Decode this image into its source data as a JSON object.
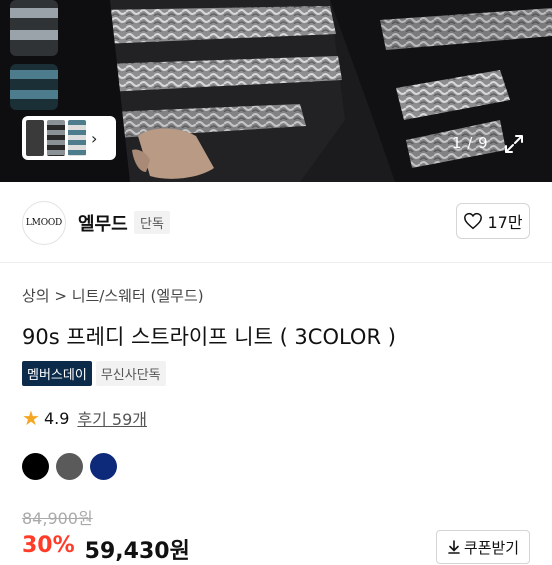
{
  "gallery": {
    "counter": "1 / 9",
    "thumb_set_arrow": "›",
    "thumb_colors": [
      "#9aa3aa",
      "#4d7d8c",
      "#2a2a2a"
    ]
  },
  "brand": {
    "logo_text": "LMOOD",
    "name": "엘무드",
    "badge": "단독",
    "like_count": "17만"
  },
  "product": {
    "breadcrumb": "상의 > 니트/스웨터 (엘무드)",
    "title": "90s 프레디 스트라이프 니트 ( 3COLOR )",
    "tags": [
      "멤버스데이",
      "무신사단독"
    ],
    "rating": "4.9",
    "review_link": "후기 59개",
    "colors": [
      "#000000",
      "#5a5a5a",
      "#0d2a7a"
    ],
    "original_price": "84,900원",
    "discount": "30%",
    "sale_price": "59,430원",
    "coupon_label": "쿠폰받기"
  },
  "colors": {
    "accent_discount": "#ff3c28",
    "tag_dark": "#0c2b4b",
    "star": "#f5a623"
  }
}
